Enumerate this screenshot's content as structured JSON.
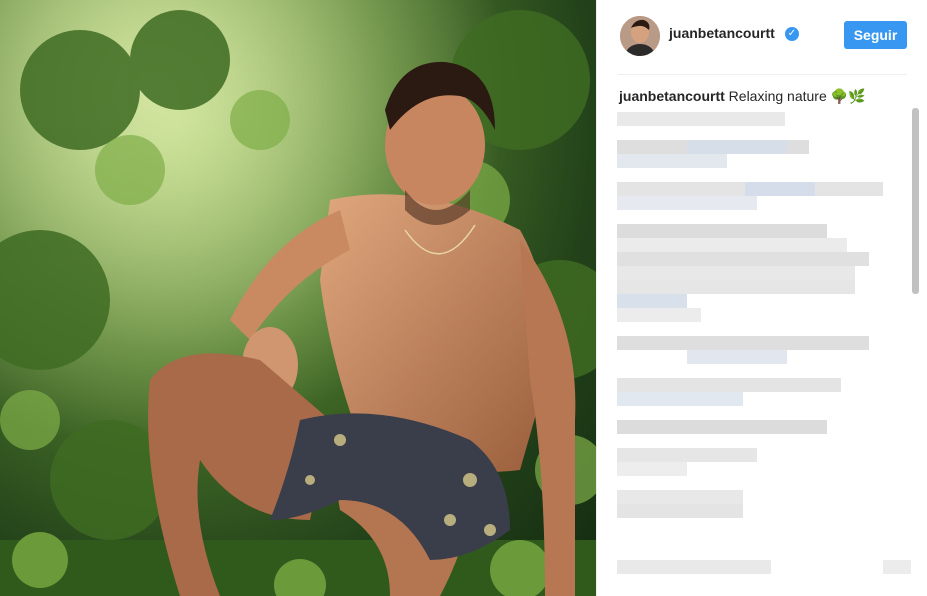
{
  "post": {
    "username": "juanbetancourtt",
    "verified_icon": "check",
    "follow_label": "Seguir",
    "caption_username": "juanbetancourtt",
    "caption_text": "Relaxing nature 🌳🌿"
  },
  "colors": {
    "accent": "#3897f0",
    "text": "#262626",
    "divider": "#efefef"
  },
  "icons": [
    "verified-badge-icon"
  ],
  "photo_subject": "shirtless man crouching in forest greenery"
}
